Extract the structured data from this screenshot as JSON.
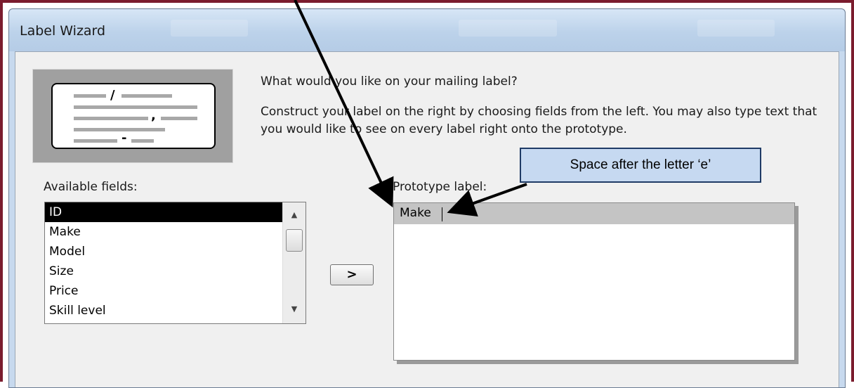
{
  "window": {
    "title": "Label Wizard"
  },
  "prompt": {
    "question": "What would you like on your mailing label?",
    "instructions": "Construct your label on the right by choosing fields from the left. You may also type text that you would like to see on every label right onto the prototype."
  },
  "available_fields": {
    "label": "Available fields:",
    "items": [
      "ID",
      "Make",
      "Model",
      "Size",
      "Price",
      "Skill level"
    ],
    "selected": "ID"
  },
  "add_button": {
    "label": ">"
  },
  "prototype": {
    "label": "Prototype label:",
    "line1": "Make "
  },
  "callout": {
    "text": "Space after the letter ‘e’"
  },
  "colors": {
    "frame": "#7b1c2e",
    "callout_fill": "#c6d9f1",
    "callout_border": "#1f3b66",
    "selection": "#000000"
  }
}
